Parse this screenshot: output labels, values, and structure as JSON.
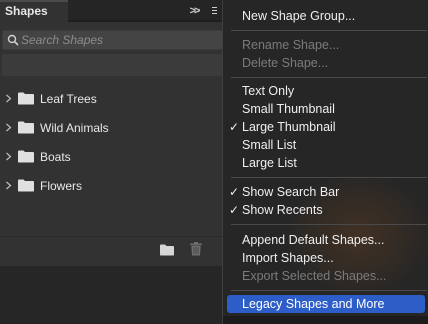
{
  "panel": {
    "tab_title": "Shapes",
    "collapse_glyph": ">>",
    "search_placeholder": "Search Shapes",
    "groups": [
      {
        "label": "Leaf Trees"
      },
      {
        "label": "Wild Animals"
      },
      {
        "label": "Boats"
      },
      {
        "label": "Flowers"
      }
    ]
  },
  "menu": {
    "new_group": "New Shape Group...",
    "rename": "Rename Shape...",
    "delete": "Delete Shape...",
    "text_only": "Text Only",
    "small_thumb": "Small Thumbnail",
    "large_thumb": "Large Thumbnail",
    "small_list": "Small List",
    "large_list": "Large List",
    "show_search": "Show Search Bar",
    "show_recents": "Show Recents",
    "append_default": "Append Default Shapes...",
    "import": "Import Shapes...",
    "export": "Export Selected Shapes...",
    "legacy": "Legacy Shapes and More",
    "check_glyph": "✓"
  },
  "colors": {
    "highlight": "#2d5ec8",
    "disabled_text": "#7b7b7b",
    "panel_bg": "#323232",
    "menu_bg": "#262626"
  }
}
